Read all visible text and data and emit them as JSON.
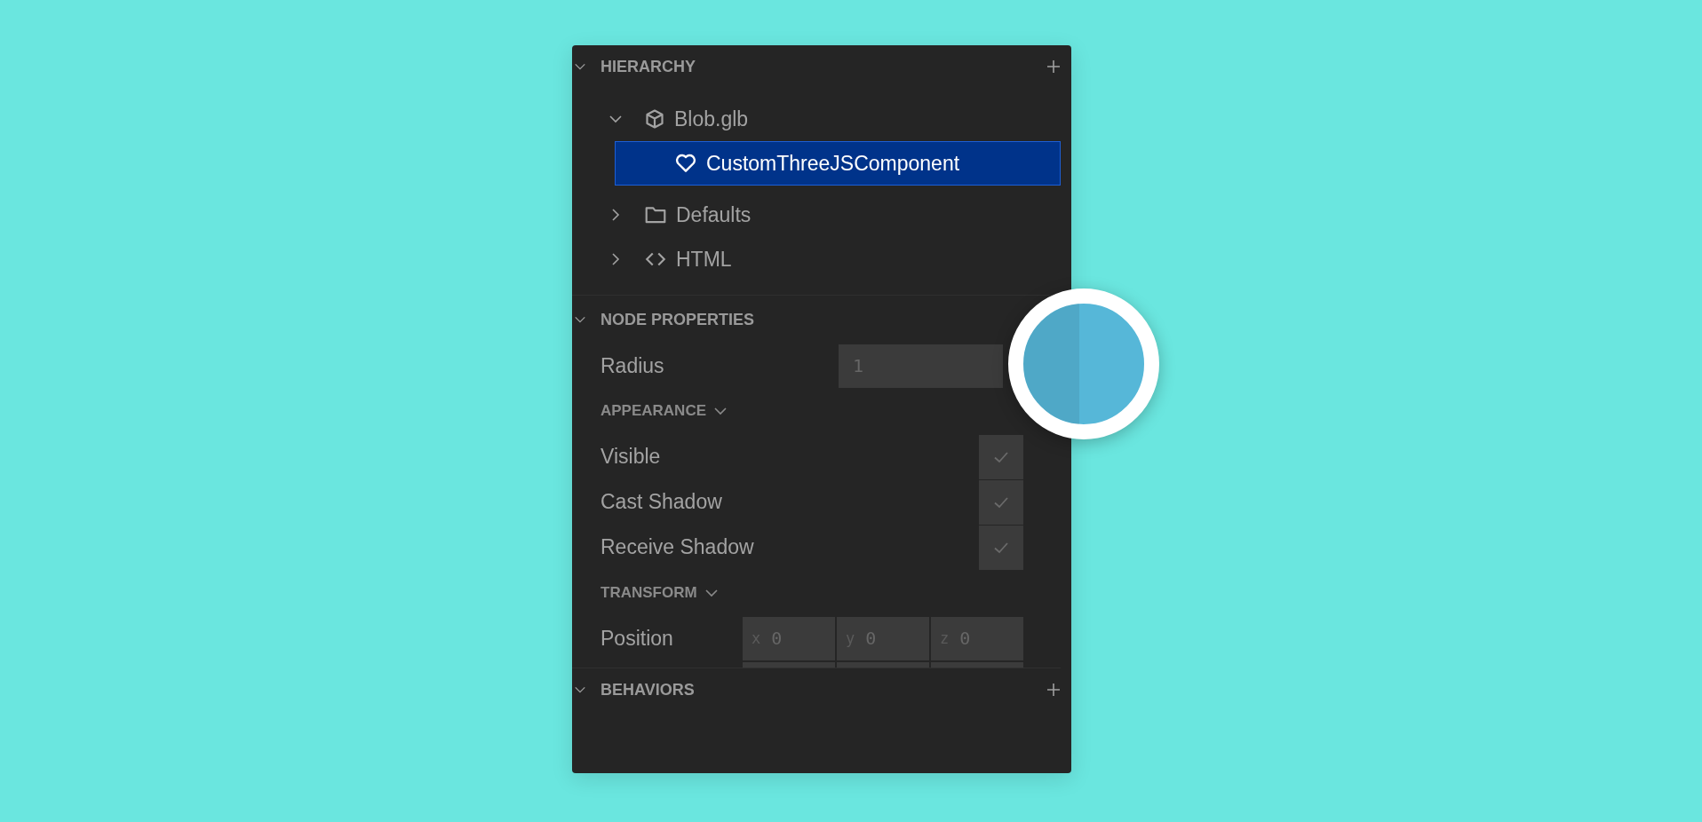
{
  "hierarchy": {
    "title": "HIERARCHY",
    "expanded": true,
    "items": [
      {
        "label": "Blob.glb",
        "kind": "model",
        "expanded": true,
        "selected": false,
        "children": [
          {
            "label": "CustomThreeJSComponent",
            "kind": "component",
            "selected": true
          }
        ]
      },
      {
        "label": "Defaults",
        "kind": "folder",
        "expanded": false,
        "selected": false
      },
      {
        "label": "HTML",
        "kind": "code",
        "expanded": false,
        "selected": false
      }
    ]
  },
  "node_properties": {
    "title": "NODE PROPERTIES",
    "expanded": true,
    "radius": {
      "label": "Radius",
      "value": "1"
    },
    "appearance": {
      "title": "APPEARANCE",
      "expanded": true,
      "options": [
        {
          "label": "Visible",
          "checked": true
        },
        {
          "label": "Cast Shadow",
          "checked": true
        },
        {
          "label": "Receive Shadow",
          "checked": true
        }
      ]
    },
    "transform": {
      "title": "TRANSFORM",
      "expanded": true,
      "position": {
        "label": "Position",
        "fields": [
          {
            "axis": "x",
            "value": "0"
          },
          {
            "axis": "y",
            "value": "0"
          },
          {
            "axis": "z",
            "value": "0"
          }
        ]
      }
    }
  },
  "behaviors": {
    "title": "BEHAVIORS",
    "expanded": true
  },
  "color_picker": {
    "color": "#56b7d8"
  }
}
